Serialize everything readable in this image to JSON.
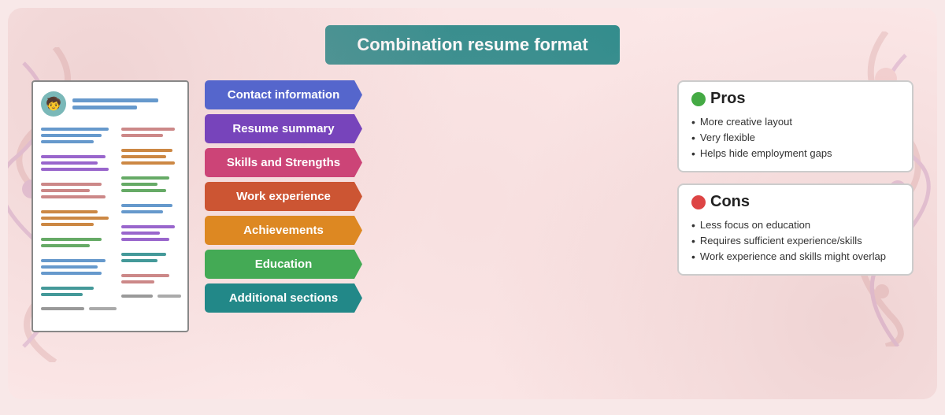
{
  "title": "Combination resume format",
  "tabs": [
    {
      "id": "contact",
      "label": "Contact information",
      "color": "tab-contact"
    },
    {
      "id": "summary",
      "label": "Resume summary",
      "color": "tab-summary"
    },
    {
      "id": "skills",
      "label": "Skills and Strengths",
      "color": "tab-skills"
    },
    {
      "id": "work",
      "label": "Work experience",
      "color": "tab-work"
    },
    {
      "id": "achievements",
      "label": "Achievements",
      "color": "tab-achievements"
    },
    {
      "id": "education",
      "label": "Education",
      "color": "tab-education"
    },
    {
      "id": "additional",
      "label": "Additional sections",
      "color": "tab-additional"
    }
  ],
  "pros": {
    "heading": "Pros",
    "items": [
      "More creative layout",
      "Very flexible",
      "Helps hide employment gaps"
    ]
  },
  "cons": {
    "heading": "Cons",
    "items": [
      "Less focus on education",
      "Requires sufficient experience/skills",
      "Work experience and skills might overlap"
    ]
  }
}
